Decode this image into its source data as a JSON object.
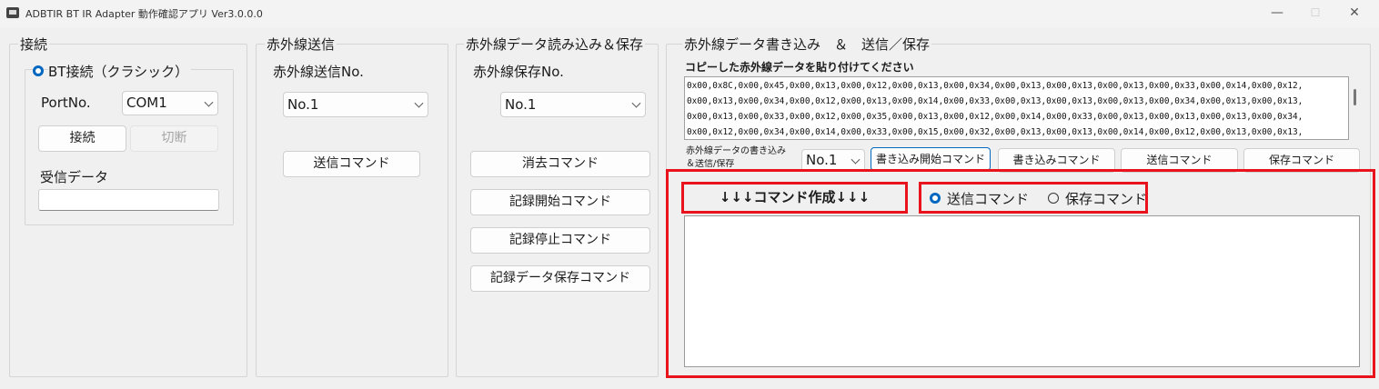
{
  "window": {
    "title": "ADBTIR BT IR Adapter 動作確認アプリ Ver3.0.0.0",
    "minimize": "—",
    "maximize": "☐",
    "close": "✕"
  },
  "connection": {
    "title": "接続",
    "mode_label": "BT接続（クラシック）",
    "port_label": "PortNo.",
    "port_value": "COM1",
    "connect_button": "接続",
    "disconnect_button": "切断",
    "receive_label": "受信データ",
    "receive_value": ""
  },
  "ir_send": {
    "title": "赤外線送信",
    "number_label": "赤外線送信No.",
    "number_value": "No.1",
    "send_button": "送信コマンド"
  },
  "ir_read": {
    "title": "赤外線データ読み込み＆保存",
    "number_label": "赤外線保存No.",
    "number_value": "No.1",
    "buttons": [
      "消去コマンド",
      "記録開始コマンド",
      "記録停止コマンド",
      "記録データ保存コマンド"
    ]
  },
  "ir_write": {
    "title": "赤外線データ書き込み　＆　送信／保存",
    "paste_label": "コピーした赤外線データを貼り付けてください",
    "data_lines": [
      "0x00,0x8C,0x00,0x45,0x00,0x13,0x00,0x12,0x00,0x13,0x00,0x34,0x00,0x13,0x00,0x13,0x00,0x13,0x00,0x33,0x00,0x14,0x00,0x12,",
      "0x00,0x13,0x00,0x34,0x00,0x12,0x00,0x13,0x00,0x14,0x00,0x33,0x00,0x13,0x00,0x13,0x00,0x13,0x00,0x34,0x00,0x13,0x00,0x13,",
      "0x00,0x13,0x00,0x33,0x00,0x12,0x00,0x35,0x00,0x13,0x00,0x12,0x00,0x14,0x00,0x33,0x00,0x13,0x00,0x13,0x00,0x13,0x00,0x34,",
      "0x00,0x12,0x00,0x34,0x00,0x14,0x00,0x33,0x00,0x15,0x00,0x32,0x00,0x13,0x00,0x13,0x00,0x14,0x00,0x12,0x00,0x13,0x00,0x13,"
    ],
    "select_label_1": "赤外線データの書き込み",
    "select_label_2": "＆送信/保存",
    "number_value": "No.1",
    "buttons": [
      "書き込み開始コマンド",
      "書き込みコマンド",
      "送信コマンド",
      "保存コマンド"
    ],
    "create_heading": "↓↓↓コマンド作成↓↓↓",
    "radio_send": "送信コマンド",
    "radio_save": "保存コマンド",
    "output_value": ""
  },
  "colors": {
    "highlight": "#e8131b",
    "accent": "#0067c0"
  }
}
